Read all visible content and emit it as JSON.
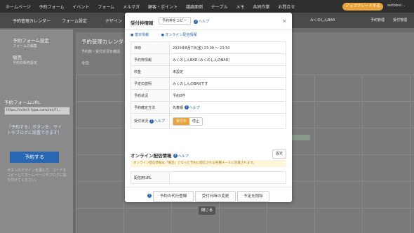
{
  "topnav": {
    "items": [
      "ホームページ",
      "予約フォーム",
      "イベント",
      "フォーム",
      "メルマガ",
      "顧客・ポイント",
      "議論面倒",
      "テーブル",
      "メモ",
      "共同作業",
      "お問合せ"
    ],
    "cta": "アップグレードする",
    "user": "setbbel..."
  },
  "subbar": {
    "menu_label": "予約管理カレンダー",
    "form_label": "フォーム設定",
    "page_label": "デザイン",
    "right_shop": "みくのしんBAR",
    "right_btn1": "予約管理",
    "right_btn2": "受付管理"
  },
  "sidebar": {
    "form_title": "予約フォーム設定",
    "form_sub": "フォームの編集",
    "sales_title": "販売",
    "sales_sub": "予約の販売設定",
    "url_label": "予約フォームURL",
    "url_value": "https://select-type.com/rsv/?i...",
    "note": "「予約する」ボタンを、サイトやブログに設置できます！",
    "reserve_button": "予約する",
    "small_text": "ボタンのデザインを選んで、コードをコピーしてホームページやブログに貼り付けてください。"
  },
  "calendar": {
    "title": "予約管理カレンダー",
    "hint": "予約数・受付状況を確認",
    "today_btn": "今日"
  },
  "modal": {
    "title": "受付枠情報",
    "copy_button": "予約枠をコピー",
    "help_label": "ヘルプ",
    "tabs": [
      "基本情報",
      "オンライン配信情報"
    ],
    "rows": [
      {
        "key": "日時",
        "value": "2020年8月7日(金) 23:00 〜 23:50"
      },
      {
        "key": "予約枠情報",
        "value": "みくのしんBAR (みくのしんのBAR)"
      },
      {
        "key": "料金",
        "value": "未設定"
      },
      {
        "key": "予定の説明",
        "value": "みくのしんのBARです"
      },
      {
        "key": "予約状況",
        "value": "予約0件"
      },
      {
        "key": "予約確定方法",
        "value": "先着順"
      }
    ],
    "status_key": "受付状況",
    "status_on": "受付中",
    "status_off": "停止",
    "online_title": "オンライン配信情報",
    "set_button": "設定",
    "notice": "オンライン配信情報は「確定」となった予約に配信される各種メールに記載されます。",
    "url_key": "配信用URL",
    "url_value": "",
    "footer": {
      "proxy": "予約の代行登録",
      "change": "受付日時の変更",
      "delete": "予定を削除"
    },
    "close": "閉じる"
  }
}
